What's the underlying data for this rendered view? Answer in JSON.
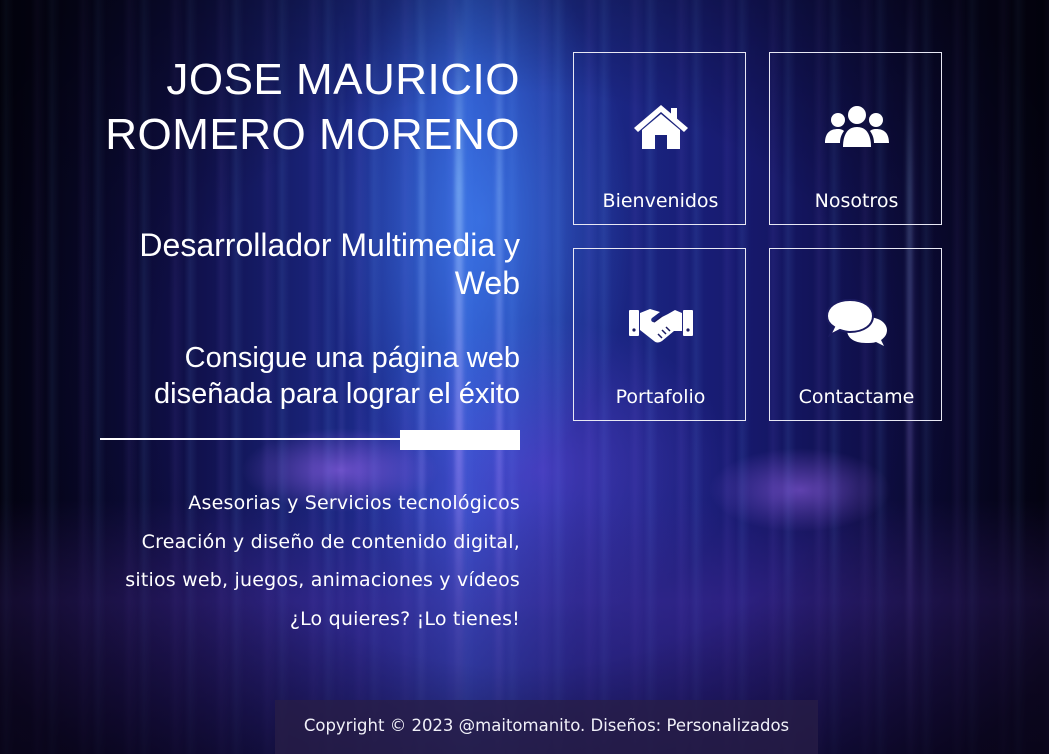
{
  "header": {
    "name_line1": "JOSE MAURICIO",
    "name_line2": "ROMERO MORENO",
    "role_line1": "Desarrollador Multimedia y",
    "role_line2": "Web",
    "tagline_line1": "Consigue una página web",
    "tagline_line2": "diseñada para lograr el éxito"
  },
  "services": [
    "Asesorias y Servicios tecnológicos",
    "Creación y diseño de contenido digital,",
    "sitios web, juegos, animaciones y vídeos",
    "¿Lo quieres? ¡Lo tienes!"
  ],
  "nav": [
    {
      "label": "Bienvenidos",
      "icon": "home-icon"
    },
    {
      "label": "Nosotros",
      "icon": "users-icon"
    },
    {
      "label": "Portafolio",
      "icon": "handshake-icon"
    },
    {
      "label": "Contactame",
      "icon": "chat-bubbles-icon"
    }
  ],
  "footer": {
    "text": "Copyright © 2023 @maitomanito. Diseños: Personalizados"
  },
  "colors": {
    "text": "#ffffff",
    "background": "#0a0830",
    "accent_blue": "#3f7bff",
    "accent_purple": "#8a5cff",
    "tile_border": "#e8e8f4",
    "footer_bg": "#281e46"
  }
}
